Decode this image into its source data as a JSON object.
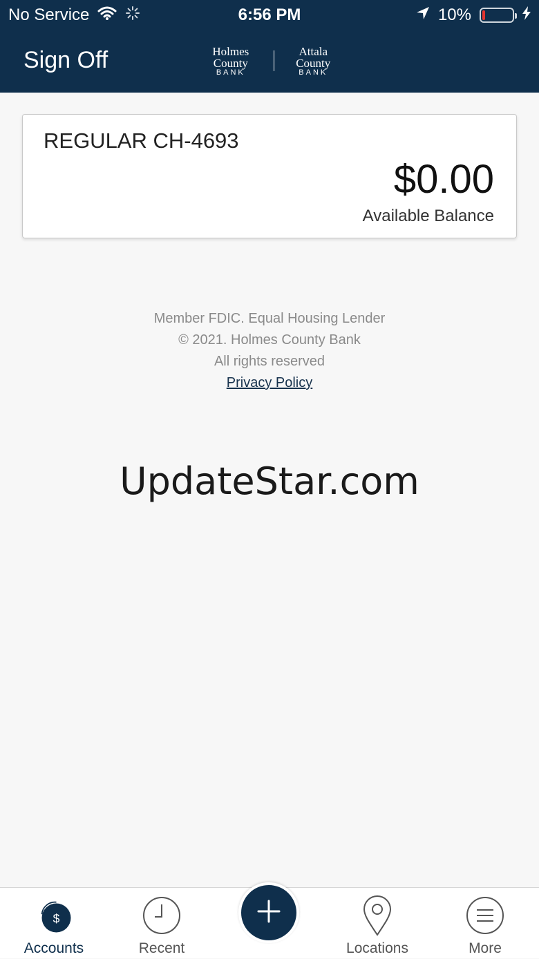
{
  "status_bar": {
    "carrier": "No Service",
    "time": "6:56 PM",
    "battery_percent": "10%",
    "battery_level": 0.1
  },
  "header": {
    "sign_off_label": "Sign Off",
    "logo": {
      "left_name": "Holmes County",
      "left_sub": "BANK",
      "right_name": "Attala County",
      "right_sub": "BANK"
    }
  },
  "account": {
    "name": "REGULAR CH-4693",
    "amount": "$0.00",
    "amount_label": "Available Balance"
  },
  "footer": {
    "line1": "Member FDIC. Equal Housing Lender",
    "line2": "© 2021. Holmes County Bank",
    "line3": "All rights reserved",
    "privacy_link": "Privacy Policy"
  },
  "watermark": "UpdateStar.com",
  "tabs": [
    {
      "label": "Accounts",
      "icon": "accounts-dollar-icon",
      "active": true
    },
    {
      "label": "Recent",
      "icon": "clock-icon",
      "active": false
    },
    {
      "label": "Locations",
      "icon": "map-pin-icon",
      "active": false
    },
    {
      "label": "More",
      "icon": "menu-icon",
      "active": false
    }
  ],
  "colors": {
    "brand": "#0f2f4c",
    "background": "#f7f7f7",
    "battery_low": "#e3342f"
  }
}
